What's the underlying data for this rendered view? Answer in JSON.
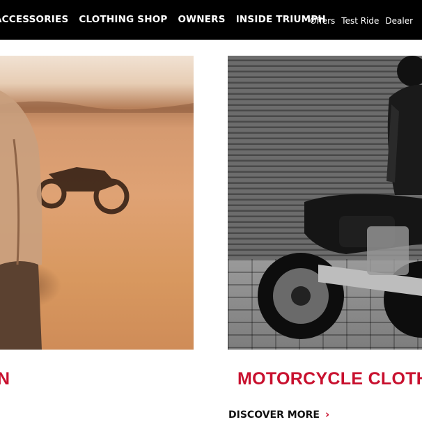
{
  "nav": {
    "main": [
      "ACCESSORIES",
      "CLOTHING SHOP",
      "OWNERS",
      "INSIDE TRIUMPH"
    ],
    "utility": [
      "Offers",
      "Test Ride",
      "Dealer"
    ]
  },
  "cards": [
    {
      "title": "N"
    },
    {
      "title": "MOTORCYCLE CLOTH",
      "link": "DISCOVER MORE",
      "link_icon": "chevron-right-icon"
    }
  ],
  "colors": {
    "nav_bg": "#000000",
    "accent": "#c8102e"
  }
}
